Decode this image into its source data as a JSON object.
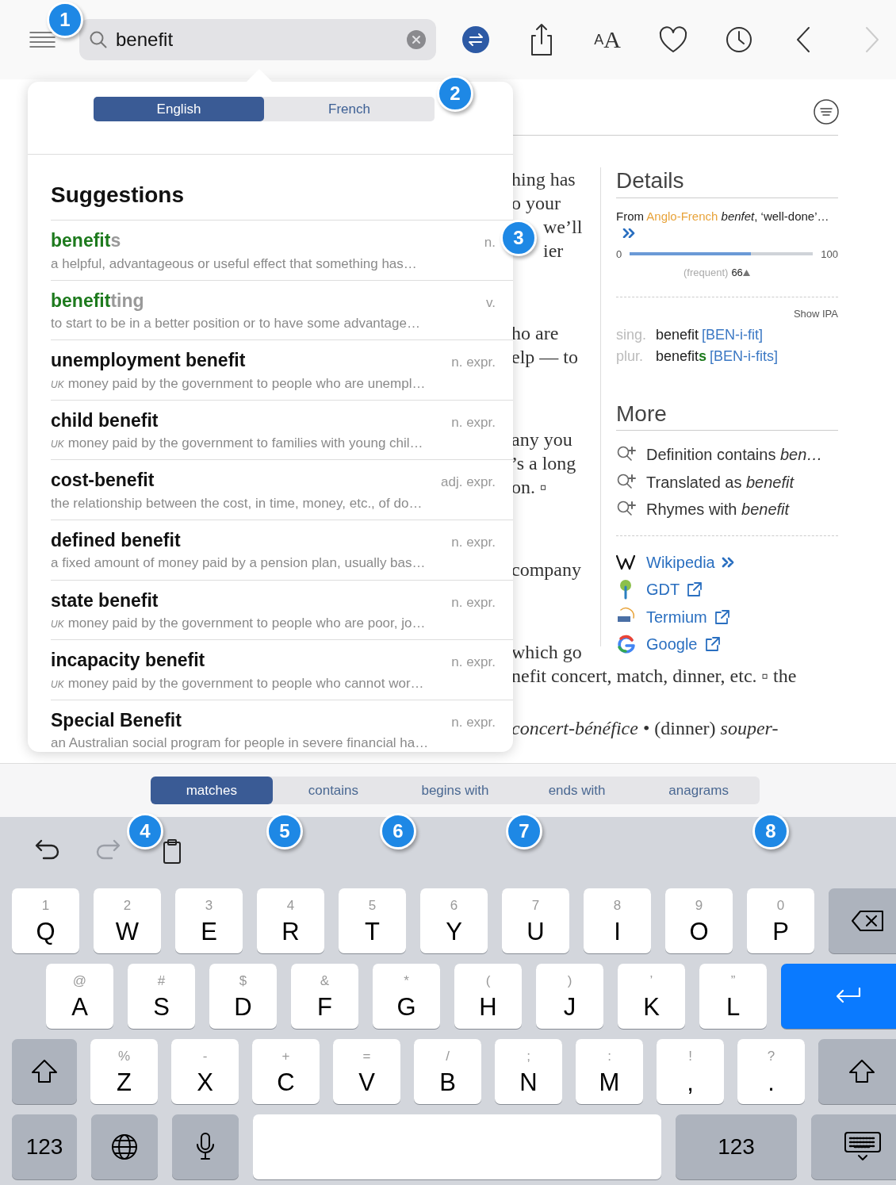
{
  "search": {
    "value": "benefit"
  },
  "toolbar": [
    {
      "kind": "swap",
      "disabled": false
    },
    {
      "kind": "share",
      "disabled": false
    },
    {
      "kind": "text-size",
      "label_small": "A",
      "label_large": "A",
      "disabled": false
    },
    {
      "kind": "favorite",
      "disabled": false
    },
    {
      "kind": "history",
      "disabled": false
    },
    {
      "kind": "back",
      "disabled": false
    },
    {
      "kind": "forward",
      "disabled": true
    }
  ],
  "popup": {
    "languages": [
      {
        "label": "English",
        "selected": true
      },
      {
        "label": "French",
        "selected": false
      }
    ],
    "heading": "Suggestions",
    "suggestions": [
      {
        "match": "benefit",
        "rest": "s",
        "pos": "n.",
        "definition": "a helpful, advantageous or useful effect that something has…"
      },
      {
        "match": "benefit",
        "rest": "ting",
        "pos": "v.",
        "definition": "to start to be in a better position or to have some advantage…"
      },
      {
        "headword": "unemployment benefit",
        "pos": "n. expr.",
        "region": "UK",
        "definition": "money paid by the government to people who are unempl…"
      },
      {
        "headword": "child benefit",
        "pos": "n. expr.",
        "region": "UK",
        "definition": "money paid by the government to families with young chil…"
      },
      {
        "headword": "cost-benefit",
        "pos": "adj. expr.",
        "definition": "the relationship between the cost, in time, money, etc., of do…"
      },
      {
        "headword": "defined benefit",
        "pos": "n. expr.",
        "definition": "a fixed amount of money paid by a pension plan, usually bas…"
      },
      {
        "headword": "state benefit",
        "pos": "n. expr.",
        "region": "UK",
        "definition": "money paid by the government to people who are poor, jo…"
      },
      {
        "headword": "incapacity benefit",
        "pos": "n. expr.",
        "region": "UK",
        "definition": "money paid by the government to people who cannot wor…"
      },
      {
        "headword": "Special Benefit",
        "pos": "n. expr.",
        "definition": "an Australian social program for people in severe financial ha…"
      }
    ]
  },
  "article": {
    "fragments": [
      [
        "hing has",
        "o your",
        "we’ll",
        "ier"
      ],
      [
        "ho are",
        "elp — to"
      ],
      [
        "any you",
        "’s a long",
        "on. ▫"
      ],
      [
        "company"
      ],
      [
        "which go"
      ]
    ],
    "lines": [
      "nefit concert, match, dinner, etc. ▫ the",
      "*concert-bénéfice* • (dinner) *souper-*"
    ]
  },
  "details": {
    "heading": "Details",
    "etymology": {
      "prefix": "From",
      "source": "Anglo-French",
      "rest": "*benfet*, ‘well-done’…"
    },
    "frequency": {
      "min": "0",
      "max": "100",
      "level": 0.66,
      "label": "(frequent)",
      "value": "66"
    },
    "show_ipa": "Show IPA",
    "forms": [
      {
        "label": "sing.",
        "word": "benefit",
        "ipa": "[BEN-i-fit]"
      },
      {
        "label": "plur.",
        "word": "benefit",
        "ending": "s",
        "ipa": "[BEN-i-fits]"
      }
    ]
  },
  "more": {
    "heading": "More",
    "searches": [
      {
        "text": "Definition contains",
        "term": "ben…"
      },
      {
        "text": "Translated as",
        "term": "benefit"
      },
      {
        "text": "Rhymes with",
        "term": "benefit"
      }
    ],
    "links": [
      {
        "kind": "wikipedia",
        "label": "Wikipedia"
      },
      {
        "kind": "gdt",
        "label": "GDT"
      },
      {
        "kind": "termium",
        "label": "Termium"
      },
      {
        "kind": "google",
        "label": "Google"
      }
    ]
  },
  "filters": [
    {
      "label": "matches",
      "selected": true
    },
    {
      "label": "contains",
      "selected": false
    },
    {
      "label": "begins with",
      "selected": false
    },
    {
      "label": "ends with",
      "selected": false
    },
    {
      "label": "anagrams",
      "selected": false
    }
  ],
  "keyboard": {
    "tools": [
      {
        "kind": "undo",
        "disabled": false
      },
      {
        "kind": "redo",
        "disabled": true
      },
      {
        "kind": "paste",
        "disabled": false
      }
    ],
    "rows": [
      [
        {
          "kind": "letter",
          "main": "Q",
          "alt": "1"
        },
        {
          "kind": "letter",
          "main": "W",
          "alt": "2"
        },
        {
          "kind": "letter",
          "main": "E",
          "alt": "3"
        },
        {
          "kind": "letter",
          "main": "R",
          "alt": "4"
        },
        {
          "kind": "letter",
          "main": "T",
          "alt": "5"
        },
        {
          "kind": "letter",
          "main": "Y",
          "alt": "6"
        },
        {
          "kind": "letter",
          "main": "U",
          "alt": "7"
        },
        {
          "kind": "letter",
          "main": "I",
          "alt": "8"
        },
        {
          "kind": "letter",
          "main": "O",
          "alt": "9"
        },
        {
          "kind": "letter",
          "main": "P",
          "alt": "0"
        },
        {
          "kind": "delete"
        }
      ],
      [
        {
          "kind": "letter",
          "main": "A",
          "alt": "@"
        },
        {
          "kind": "letter",
          "main": "S",
          "alt": "#"
        },
        {
          "kind": "letter",
          "main": "D",
          "alt": "$"
        },
        {
          "kind": "letter",
          "main": "F",
          "alt": "&"
        },
        {
          "kind": "letter",
          "main": "G",
          "alt": "*"
        },
        {
          "kind": "letter",
          "main": "H",
          "alt": "("
        },
        {
          "kind": "letter",
          "main": "J",
          "alt": ")"
        },
        {
          "kind": "letter",
          "main": "K",
          "alt": "’"
        },
        {
          "kind": "letter",
          "main": "L",
          "alt": "”"
        },
        {
          "kind": "return"
        }
      ],
      [
        {
          "kind": "shift"
        },
        {
          "kind": "letter",
          "main": "Z",
          "alt": "%"
        },
        {
          "kind": "letter",
          "main": "X",
          "alt": "-"
        },
        {
          "kind": "letter",
          "main": "C",
          "alt": "+"
        },
        {
          "kind": "letter",
          "main": "V",
          "alt": "="
        },
        {
          "kind": "letter",
          "main": "B",
          "alt": "/"
        },
        {
          "kind": "letter",
          "main": "N",
          "alt": ";"
        },
        {
          "kind": "letter",
          "main": "M",
          "alt": ":"
        },
        {
          "kind": "punct",
          "main": ",",
          "alt": "!"
        },
        {
          "kind": "punct",
          "main": ".",
          "alt": "?"
        },
        {
          "kind": "shift"
        }
      ],
      [
        {
          "kind": "numbers",
          "label": "123"
        },
        {
          "kind": "globe"
        },
        {
          "kind": "mic"
        },
        {
          "kind": "space"
        },
        {
          "kind": "numbers",
          "label": "123"
        },
        {
          "kind": "hide"
        }
      ]
    ]
  },
  "callouts": [
    "1",
    "2",
    "3",
    "4",
    "5",
    "6",
    "7",
    "8"
  ]
}
